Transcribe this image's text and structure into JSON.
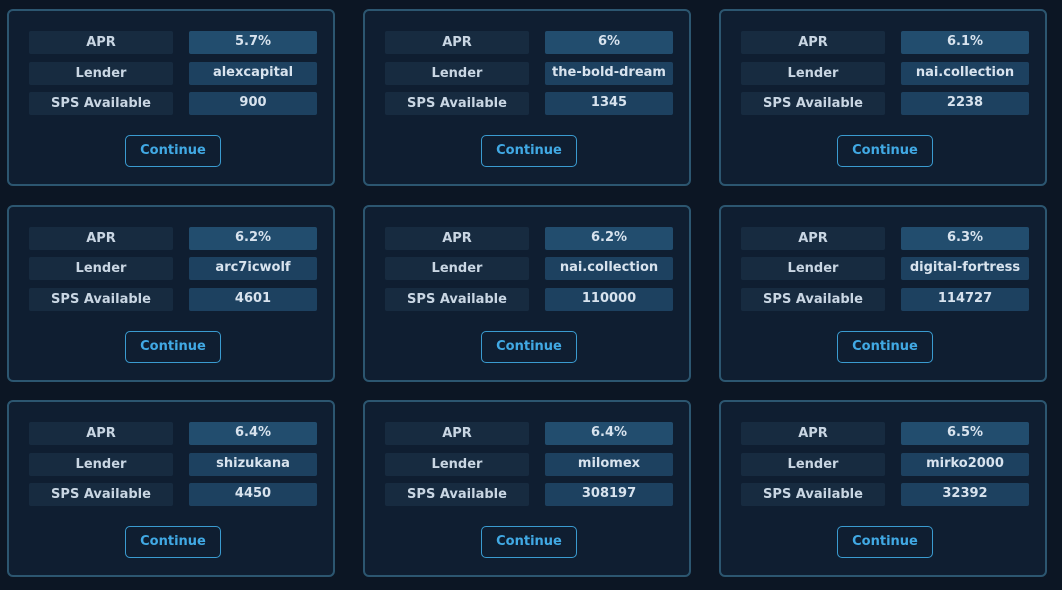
{
  "labels": {
    "apr": "APR",
    "lender": "Lender",
    "sps_available": "SPS Available",
    "continue": "Continue"
  },
  "offers": [
    {
      "apr": "5.7%",
      "lender": "alexcapital",
      "sps_available": "900"
    },
    {
      "apr": "6%",
      "lender": "the-bold-dream",
      "sps_available": "1345"
    },
    {
      "apr": "6.1%",
      "lender": "nai.collection",
      "sps_available": "2238"
    },
    {
      "apr": "6.2%",
      "lender": "arc7icwolf",
      "sps_available": "4601"
    },
    {
      "apr": "6.2%",
      "lender": "nai.collection",
      "sps_available": "110000"
    },
    {
      "apr": "6.3%",
      "lender": "digital-fortress",
      "sps_available": "114727"
    },
    {
      "apr": "6.4%",
      "lender": "shizukana",
      "sps_available": "4450"
    },
    {
      "apr": "6.4%",
      "lender": "milomex",
      "sps_available": "308197"
    },
    {
      "apr": "6.5%",
      "lender": "mirko2000",
      "sps_available": "32392"
    }
  ],
  "colors": {
    "background": "#0c1624",
    "card_border": "#2c5670",
    "button_accent": "#41a9e4"
  }
}
